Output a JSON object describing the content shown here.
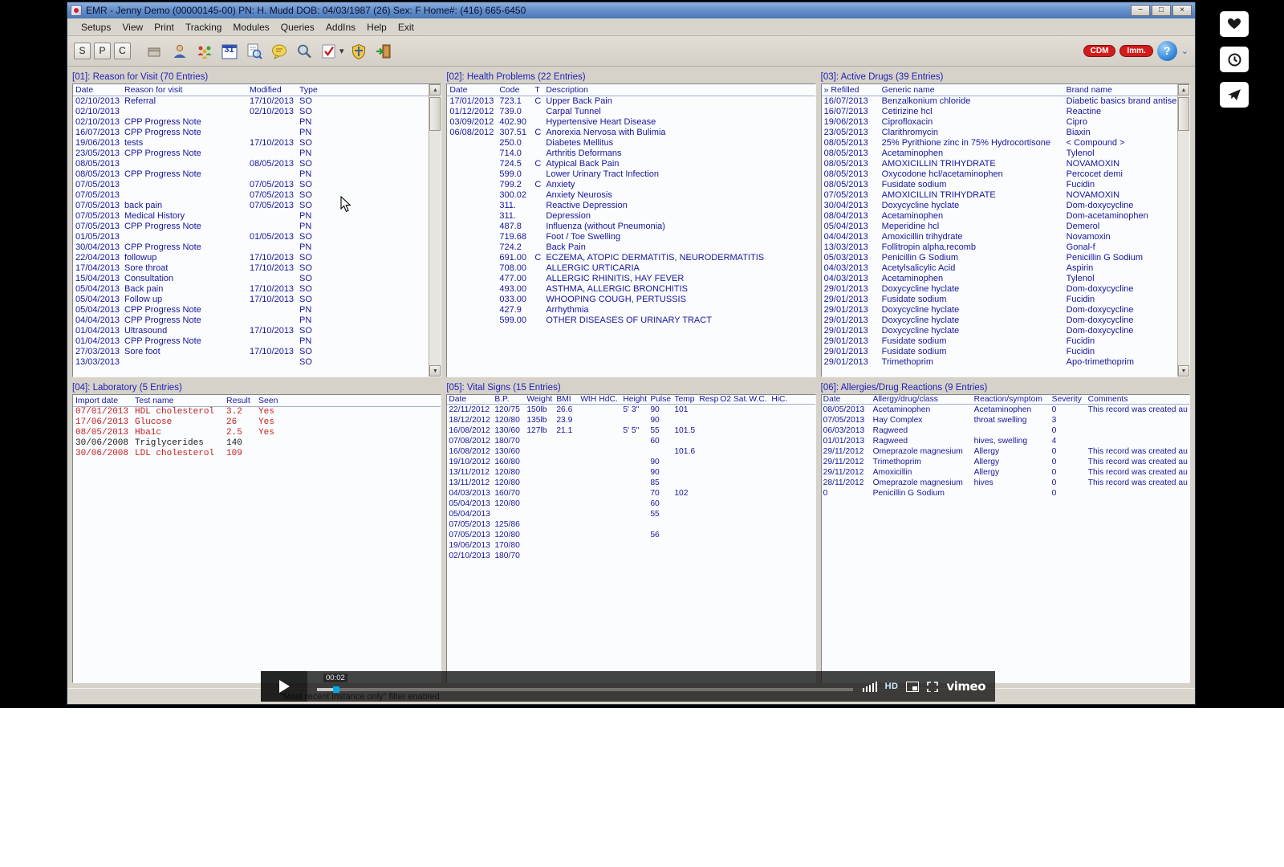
{
  "colors": {
    "accent_blue": "#00a8e8",
    "badge_red": "#d21c1c",
    "navy_text": "#16169a",
    "lab_red": "#c42020"
  },
  "window": {
    "title": "EMR - Jenny Demo (00000145-00)    PN: H. Mudd    DOB: 04/03/1987 (26)    Sex: F   Home#: (416) 665-6450",
    "controls": {
      "minimize": "−",
      "maximize": "□",
      "close": "×"
    },
    "menu": [
      "Setups",
      "View",
      "Print",
      "Tracking",
      "Modules",
      "Queries",
      "AddIns",
      "Help",
      "Exit"
    ],
    "toolbar": {
      "s": "S",
      "p": "P",
      "c": "C",
      "calendar_label": "31",
      "dropdown_caret": "▾",
      "badges": [
        {
          "label": "CDM"
        },
        {
          "label": "Imm."
        }
      ],
      "help_label": "?",
      "chevron": "❯"
    },
    "status_bar": "\"Most recent instance only\" filter enabled"
  },
  "panels": {
    "reason": {
      "title": "[01]: Reason for Visit (70 Entries)",
      "columns": [
        "Date",
        "Reason for visit",
        "Modified",
        "Type"
      ],
      "rows": [
        [
          "02/10/2013",
          "Referral",
          "17/10/2013",
          "SO"
        ],
        [
          "02/10/2013",
          "",
          "02/10/2013",
          "SO"
        ],
        [
          "02/10/2013",
          "CPP Progress Note",
          "",
          "PN"
        ],
        [
          "16/07/2013",
          "CPP Progress Note",
          "",
          "PN"
        ],
        [
          "19/06/2013",
          "tests",
          "17/10/2013",
          "SO"
        ],
        [
          "23/05/2013",
          "CPP Progress Note",
          "",
          "PN"
        ],
        [
          "08/05/2013",
          "",
          "08/05/2013",
          "SO"
        ],
        [
          "08/05/2013",
          "CPP Progress Note",
          "",
          "PN"
        ],
        [
          "07/05/2013",
          "",
          "07/05/2013",
          "SO"
        ],
        [
          "07/05/2013",
          "",
          "07/05/2013",
          "SO"
        ],
        [
          "07/05/2013",
          "back pain",
          "07/05/2013",
          "SO"
        ],
        [
          "07/05/2013",
          "Medical History",
          "",
          "PN"
        ],
        [
          "07/05/2013",
          "CPP Progress Note",
          "",
          "PN"
        ],
        [
          "01/05/2013",
          "",
          "01/05/2013",
          "SO"
        ],
        [
          "30/04/2013",
          "CPP Progress Note",
          "",
          "PN"
        ],
        [
          "22/04/2013",
          "followup",
          "17/10/2013",
          "SO"
        ],
        [
          "17/04/2013",
          "Sore throat",
          "17/10/2013",
          "SO"
        ],
        [
          "15/04/2013",
          "Consultation",
          "",
          "SO"
        ],
        [
          "05/04/2013",
          "Back pain",
          "17/10/2013",
          "SO"
        ],
        [
          "05/04/2013",
          "Follow up",
          "17/10/2013",
          "SO"
        ],
        [
          "05/04/2013",
          "CPP Progress Note",
          "",
          "PN"
        ],
        [
          "04/04/2013",
          "CPP Progress Note",
          "",
          "PN"
        ],
        [
          "01/04/2013",
          "Ultrasound",
          "17/10/2013",
          "SO"
        ],
        [
          "01/04/2013",
          "CPP Progress Note",
          "",
          "PN"
        ],
        [
          "27/03/2013",
          "Sore foot",
          "17/10/2013",
          "SO"
        ],
        [
          "13/03/2013",
          "",
          "",
          "SO"
        ]
      ]
    },
    "problems": {
      "title": "[02]: Health Problems (22 Entries)",
      "columns": [
        "Date",
        "Code",
        "T",
        "Description"
      ],
      "rows": [
        [
          "17/01/2013",
          "723.1",
          "C",
          "Upper Back Pain"
        ],
        [
          "01/12/2012",
          "739.0",
          "",
          "Carpal Tunnel"
        ],
        [
          "03/09/2012",
          "402.90",
          "",
          "Hypertensive Heart Disease"
        ],
        [
          "06/08/2012",
          "307.51",
          "C",
          "Anorexia Nervosa with Bulimia"
        ],
        [
          "",
          "250.0",
          "",
          "Diabetes Mellitus"
        ],
        [
          "",
          "714.0",
          "",
          "Arthritis Deformans"
        ],
        [
          "",
          "724.5",
          "C",
          "Atypical Back Pain"
        ],
        [
          "",
          "599.0",
          "",
          "Lower Urinary Tract Infection"
        ],
        [
          "",
          "799.2",
          "C",
          "Anxiety"
        ],
        [
          "",
          "300.02",
          "",
          "Anxiety Neurosis"
        ],
        [
          "",
          "311.",
          "",
          "Reactive Depression"
        ],
        [
          "",
          "311.",
          "",
          "Depression"
        ],
        [
          "",
          "487.8",
          "",
          "Influenza (without Pneumonia)"
        ],
        [
          "",
          "719.68",
          "",
          "Foot / Toe Swelling"
        ],
        [
          "",
          "724.2",
          "",
          "Back Pain"
        ],
        [
          "",
          "691.00",
          "C",
          "ECZEMA, ATOPIC DERMATITIS, NEURODERMATITIS"
        ],
        [
          "",
          "708.00",
          "",
          "ALLERGIC URTICARIA"
        ],
        [
          "",
          "477.00",
          "",
          "ALLERGIC RHINITIS, HAY FEVER"
        ],
        [
          "",
          "493.00",
          "",
          "ASTHMA, ALLERGIC BRONCHITIS"
        ],
        [
          "",
          "033.00",
          "",
          "WHOOPING COUGH, PERTUSSIS"
        ],
        [
          "",
          "427.9",
          "",
          "Arrhythmia"
        ],
        [
          "",
          "599.00",
          "",
          "OTHER DISEASES OF URINARY TRACT"
        ]
      ]
    },
    "drugs": {
      "title": "[03]: Active Drugs (39 Entries)",
      "columns": [
        "» Refilled",
        "Generic name",
        "Brand name"
      ],
      "rows": [
        [
          "16/07/2013",
          "Benzalkonium chloride",
          "Diabetic basics brand antisep"
        ],
        [
          "16/07/2013",
          "Cetirizine hcl",
          "Reactine"
        ],
        [
          "19/06/2013",
          "Ciprofloxacin",
          "Cipro"
        ],
        [
          "23/05/2013",
          "Clarithromycin",
          "Biaxin"
        ],
        [
          "08/05/2013",
          "25% Pyrithione zinc  in  75% Hydrocortisone",
          "< Compound >"
        ],
        [
          "08/05/2013",
          "Acetaminophen",
          "Tylenol"
        ],
        [
          "08/05/2013",
          "AMOXICILLIN TRIHYDRATE",
          "NOVAMOXIN"
        ],
        [
          "08/05/2013",
          "Oxycodone hcl/acetaminophen",
          "Percocet demi"
        ],
        [
          "08/05/2013",
          "Fusidate sodium",
          "Fucidin"
        ],
        [
          "07/05/2013",
          "AMOXICILLIN TRIHYDRATE",
          "NOVAMOXIN"
        ],
        [
          "30/04/2013",
          "Doxycycline hyclate",
          "Dom-doxycycline"
        ],
        [
          "08/04/2013",
          "Acetaminophen",
          "Dom-acetaminophen"
        ],
        [
          "05/04/2013",
          "Meperidine hcl",
          "Demerol"
        ],
        [
          "04/04/2013",
          "Amoxicillin trihydrate",
          "Novamoxin"
        ],
        [
          "13/03/2013",
          "Follitropin alpha,recomb",
          "Gonal-f"
        ],
        [
          "05/03/2013",
          "Penicillin G Sodium",
          "Penicillin G Sodium"
        ],
        [
          "04/03/2013",
          "Acetylsalicylic Acid",
          "Aspirin"
        ],
        [
          "04/03/2013",
          "Acetaminophen",
          "Tylenol"
        ],
        [
          "29/01/2013",
          "Doxycycline hyclate",
          "Dom-doxycycline"
        ],
        [
          "29/01/2013",
          "Fusidate sodium",
          "Fucidin"
        ],
        [
          "29/01/2013",
          "Doxycycline hyclate",
          "Dom-doxycycline"
        ],
        [
          "29/01/2013",
          "Doxycycline hyclate",
          "Dom-doxycycline"
        ],
        [
          "29/01/2013",
          "Doxycycline hyclate",
          "Dom-doxycycline"
        ],
        [
          "29/01/2013",
          "Fusidate sodium",
          "Fucidin"
        ],
        [
          "29/01/2013",
          "Fusidate sodium",
          "Fucidin"
        ],
        [
          "29/01/2013",
          "Trimethoprim",
          "Apo-trimethoprim"
        ]
      ]
    },
    "laboratory": {
      "title": "[04]: Laboratory (5 Entries)",
      "columns": [
        "Import date",
        "Test name",
        "Result",
        "Seen"
      ],
      "rows": [
        {
          "cells": [
            "07/01/2013",
            "HDL cholesterol",
            "3.2",
            "Yes"
          ],
          "red": true
        },
        {
          "cells": [
            "17/06/2013",
            "Glucose",
            "26",
            "Yes"
          ],
          "red": true
        },
        {
          "cells": [
            "08/05/2013",
            "Hba1c",
            "2.5",
            "Yes"
          ],
          "red": true
        },
        {
          "cells": [
            "30/06/2008",
            "Triglycerides",
            "140",
            ""
          ],
          "red": false
        },
        {
          "cells": [
            "30/06/2008",
            "LDL cholesterol",
            "109",
            ""
          ],
          "red": true
        }
      ]
    },
    "vitals": {
      "title": "[05]: Vital Signs (15 Entries)",
      "columns": [
        "Date",
        "B.P.",
        "Weight",
        "BMI",
        "WtH",
        "HdC.",
        "Height",
        "Pulse",
        "Temp",
        "Resp",
        "O2 Sat.",
        "W.C.",
        "HiC."
      ],
      "rows": [
        [
          "22/11/2012",
          "120/75",
          "150lb",
          "26.6",
          "",
          "",
          "5' 3\"",
          "90",
          "101",
          "",
          "",
          "",
          ""
        ],
        [
          "18/12/2012",
          "120/80",
          "135lb",
          "23.9",
          "",
          "",
          "",
          "90",
          "",
          "",
          "",
          "",
          ""
        ],
        [
          "16/08/2012",
          "130/60",
          "127lb",
          "21.1",
          "",
          "",
          "5' 5\"",
          "55",
          "101.5",
          "",
          "",
          "",
          ""
        ],
        [
          "07/08/2012",
          "180/70",
          "",
          "",
          "",
          "",
          "",
          "60",
          "",
          "",
          "",
          "",
          ""
        ],
        [
          "16/08/2012",
          "130/60",
          "",
          "",
          "",
          "",
          "",
          "",
          "101.6",
          "",
          "",
          "",
          ""
        ],
        [
          "19/10/2012",
          "160/80",
          "",
          "",
          "",
          "",
          "",
          "90",
          "",
          "",
          "",
          "",
          ""
        ],
        [
          "13/11/2012",
          "120/80",
          "",
          "",
          "",
          "",
          "",
          "90",
          "",
          "",
          "",
          "",
          ""
        ],
        [
          "13/11/2012",
          "120/80",
          "",
          "",
          "",
          "",
          "",
          "85",
          "",
          "",
          "",
          "",
          ""
        ],
        [
          "04/03/2013",
          "160/70",
          "",
          "",
          "",
          "",
          "",
          "70",
          "102",
          "",
          "",
          "",
          ""
        ],
        [
          "05/04/2013",
          "120/80",
          "",
          "",
          "",
          "",
          "",
          "60",
          "",
          "",
          "",
          "",
          ""
        ],
        [
          "05/04/2013",
          "",
          "",
          "",
          "",
          "",
          "",
          "55",
          "",
          "",
          "",
          "",
          ""
        ],
        [
          "07/05/2013",
          "125/86",
          "",
          "",
          "",
          "",
          "",
          "",
          "",
          "",
          "",
          "",
          ""
        ],
        [
          "07/05/2013",
          "120/80",
          "",
          "",
          "",
          "",
          "",
          "56",
          "",
          "",
          "",
          "",
          ""
        ],
        [
          "19/06/2013",
          "170/80",
          "",
          "",
          "",
          "",
          "",
          "",
          "",
          "",
          "",
          "",
          ""
        ],
        [
          "02/10/2013",
          "180/70",
          "",
          "",
          "",
          "",
          "",
          "",
          "",
          "",
          "",
          "",
          ""
        ]
      ]
    },
    "allergies": {
      "title": "[06]: Allergies/Drug Reactions (9 Entries)",
      "columns": [
        "Date",
        "Allergy/drug/class",
        "Reaction/symptom",
        "Severity",
        "Comments"
      ],
      "rows": [
        [
          "08/05/2013",
          "Acetaminophen",
          "Acetaminophen",
          "0",
          "This record was created au"
        ],
        [
          "07/05/2013",
          "Hay Complex",
          "throat swelling",
          "3",
          ""
        ],
        [
          "06/03/2013",
          "Ragweed",
          "",
          "0",
          ""
        ],
        [
          "01/01/2013",
          "Ragweed",
          "hives, swelling",
          "4",
          ""
        ],
        [
          "29/11/2012",
          "Omeprazole magnesium",
          "Allergy",
          "0",
          "This record was created au"
        ],
        [
          "29/11/2012",
          "Trimethoprim",
          "Allergy",
          "0",
          "This record was created au"
        ],
        [
          "29/11/2012",
          "Amoxicillin",
          "Allergy",
          "0",
          "This record was created au"
        ],
        [
          "28/11/2012",
          "Omeprazole magnesium",
          "hives",
          "0",
          "This record was created au"
        ],
        [
          "0",
          "Penicillin G Sodium",
          "",
          "0",
          ""
        ]
      ]
    }
  },
  "player": {
    "time": "00:02",
    "hd_label": "HD",
    "brand": "vimeo"
  }
}
